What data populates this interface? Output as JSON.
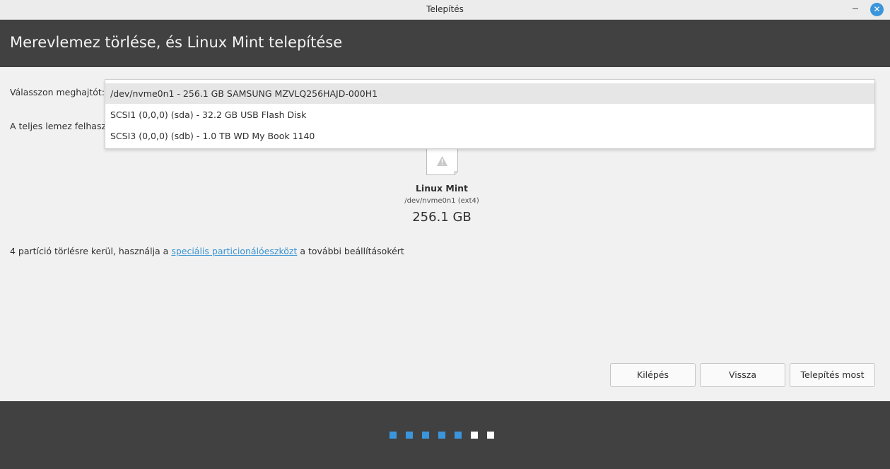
{
  "window": {
    "title": "Telepítés"
  },
  "header": {
    "title": "Merevlemez törlése, és Linux Mint telepítése"
  },
  "drive_select": {
    "label": "Válasszon meghajtót:",
    "options": [
      "/dev/nvme0n1 - 256.1 GB SAMSUNG MZVLQ256HAJD-000H1",
      "SCSI1 (0,0,0) (sda) - 32.2 GB USB Flash Disk",
      "SCSI3 (0,0,0) (sdb) - 1.0 TB WD My Book 1140"
    ],
    "selected_index": 0
  },
  "full_disk_label": "A teljes lemez felhaszn",
  "disk": {
    "icon": "warning-icon",
    "name": "Linux Mint",
    "device": "/dev/nvme0n1 (ext4)",
    "size": "256.1 GB"
  },
  "info": {
    "prefix": "4 partíció törlésre kerül, használja a ",
    "link": "speciális particionálóeszközt",
    "suffix": " a további beállításokért"
  },
  "buttons": {
    "quit": "Kilépés",
    "back": "Vissza",
    "install": "Telepítés most"
  },
  "progress": {
    "total_steps": 7,
    "completed_steps": 5
  },
  "colors": {
    "accent": "#3b95db",
    "header_bg": "#414141",
    "link": "#3a93d1"
  }
}
